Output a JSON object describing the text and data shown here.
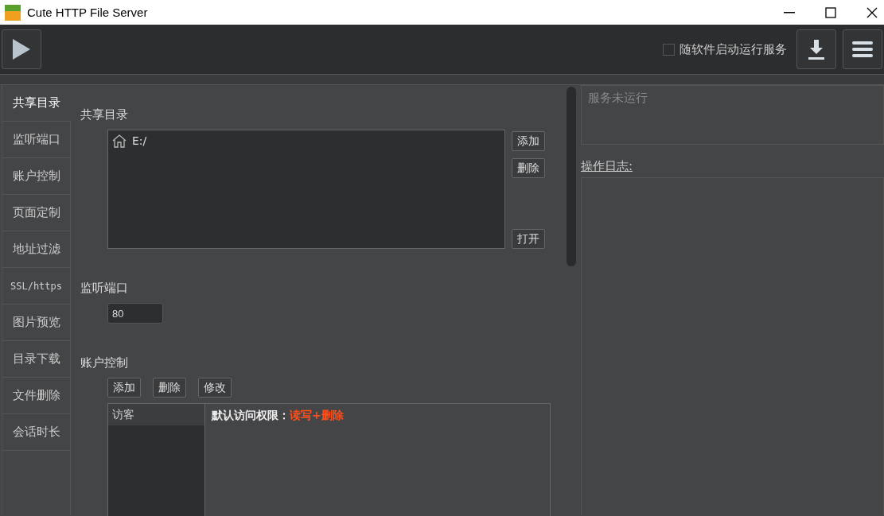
{
  "window": {
    "title": "Cute HTTP File Server"
  },
  "toolbar": {
    "autostart": {
      "label": "随软件启动运行服务",
      "checked": false
    }
  },
  "tabs": [
    {
      "label": "共享目录",
      "selected": true
    },
    {
      "label": "监听端口",
      "selected": false
    },
    {
      "label": "账户控制",
      "selected": false
    },
    {
      "label": "页面定制",
      "selected": false
    },
    {
      "label": "地址过滤",
      "selected": false
    },
    {
      "label": "SSL/https",
      "selected": false
    },
    {
      "label": "图片预览",
      "selected": false
    },
    {
      "label": "目录下载",
      "selected": false
    },
    {
      "label": "文件删除",
      "selected": false
    },
    {
      "label": "会话时长",
      "selected": false
    }
  ],
  "shared_dirs": {
    "heading": "共享目录",
    "items": [
      "E:/"
    ],
    "buttons": [
      "添加",
      "删除",
      "打开"
    ]
  },
  "port": {
    "heading": "监听端口",
    "value": "80"
  },
  "accounts": {
    "heading": "账户控制",
    "buttons": [
      "添加",
      "删除",
      "修改"
    ],
    "users": [
      {
        "name": "访客",
        "selected": true
      }
    ],
    "permission_label": "默认访问权限：",
    "permission_value": "读写+删除"
  },
  "status": {
    "text": "服务未运行"
  },
  "log": {
    "heading": "操作日志:"
  }
}
